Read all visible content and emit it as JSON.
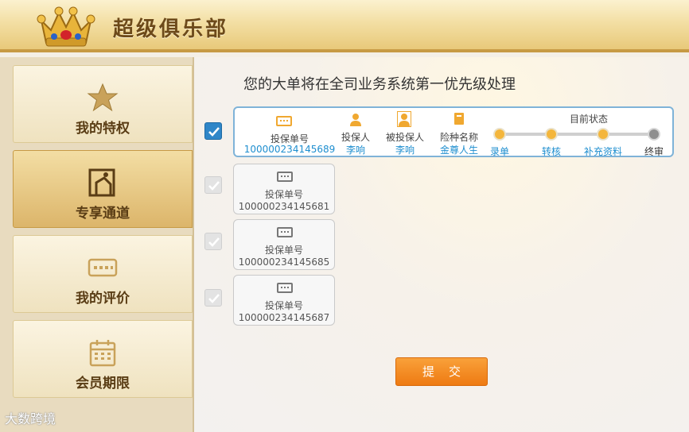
{
  "header": {
    "title": "超级俱乐部"
  },
  "sidebar": {
    "items": [
      {
        "label": "我的特权",
        "icon": "star-icon",
        "active": false
      },
      {
        "label": "专享通道",
        "icon": "door-icon",
        "active": true
      },
      {
        "label": "我的评价",
        "icon": "comment-icon",
        "active": false
      },
      {
        "label": "会员期限",
        "icon": "calendar-icon",
        "active": false
      }
    ]
  },
  "main": {
    "headline": "您的大单将在全司业务系统第一优先级处理",
    "selected_order": {
      "checked": true,
      "policy_label": "投保单号",
      "policy_number": "100000234145689",
      "insured_label": "投保人",
      "insured_name": "李响",
      "beneficiary_label": "被投保人",
      "beneficiary_name": "李响",
      "product_label": "险种名称",
      "product_name": "金尊人生",
      "status_title": "目前状态",
      "steps": [
        {
          "label": "录单",
          "done": true
        },
        {
          "label": "转核",
          "done": true
        },
        {
          "label": "补充资料",
          "done": true
        },
        {
          "label": "终审",
          "done": false
        }
      ]
    },
    "other_orders": [
      {
        "label": "投保单号",
        "number": "100000234145681"
      },
      {
        "label": "投保单号",
        "number": "100000234145685"
      },
      {
        "label": "投保单号",
        "number": "100000234145687"
      }
    ],
    "submit_label": "提交"
  },
  "watermark": "大数跨境",
  "colors": {
    "accent_blue": "#1e8ecf",
    "submit_orange": "#f08a1e",
    "gold": "#c79a44"
  }
}
